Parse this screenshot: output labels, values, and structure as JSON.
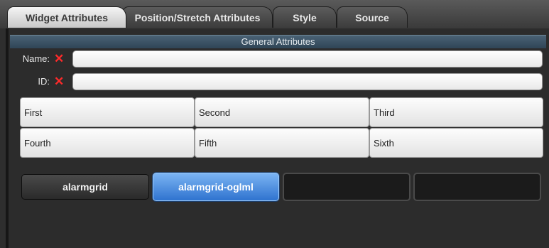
{
  "tabs": [
    {
      "label": "Widget Attributes",
      "active": true
    },
    {
      "label": "Position/Stretch Attributes",
      "active": false
    },
    {
      "label": "Style",
      "active": false
    },
    {
      "label": "Source",
      "active": false
    }
  ],
  "section_header": "General Attributes",
  "fields": {
    "name": {
      "label": "Name:",
      "value": ""
    },
    "id": {
      "label": "ID:",
      "value": ""
    }
  },
  "grid": [
    "First",
    "Second",
    "Third",
    "Fourth",
    "Fifth",
    "Sixth"
  ],
  "class_buttons": [
    {
      "label": "alarmgrid",
      "state": "normal"
    },
    {
      "label": "alarmgrid-oglml",
      "state": "selected"
    },
    {
      "label": "",
      "state": "empty"
    },
    {
      "label": "",
      "state": "empty"
    }
  ],
  "colors": {
    "accent_blue": "#3f86e0",
    "required_icon": "#ff2a2a",
    "header_bg": "#3b5163"
  },
  "icons": {
    "required": "close-x-icon"
  }
}
